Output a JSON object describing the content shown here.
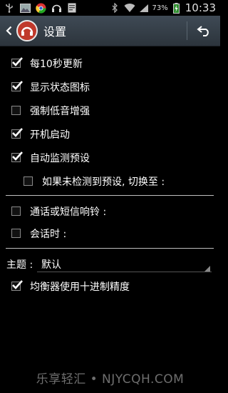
{
  "status_bar": {
    "battery_percent": "73%",
    "time": "10:33",
    "icons": [
      "usb-icon",
      "image-icon",
      "chrome-icon",
      "headphones-icon",
      "doc-icon",
      "bluetooth-icon",
      "wifi-icon",
      "signal-icon",
      "battery-icon"
    ]
  },
  "action_bar": {
    "title": "设置"
  },
  "settings": {
    "item1": {
      "label": "每10秒更新",
      "checked": true
    },
    "item2": {
      "label": "显示状态图标",
      "checked": true
    },
    "item3": {
      "label": "强制低音增强",
      "checked": false
    },
    "item4": {
      "label": "开机启动",
      "checked": true
    },
    "item5": {
      "label": "自动监测预设",
      "checked": true
    },
    "item6": {
      "label": "如果未检测到预设, 切换至 :",
      "checked": false
    },
    "item7": {
      "label": "通话或短信响铃 :",
      "checked": false
    },
    "item8": {
      "label": "会话时 :",
      "checked": false
    },
    "item9": {
      "label": "均衡器使用十进制精度",
      "checked": true
    }
  },
  "theme": {
    "key": "主题 :",
    "value": "默认"
  },
  "watermark": "乐享轻汇 • NJYCQH.COM"
}
